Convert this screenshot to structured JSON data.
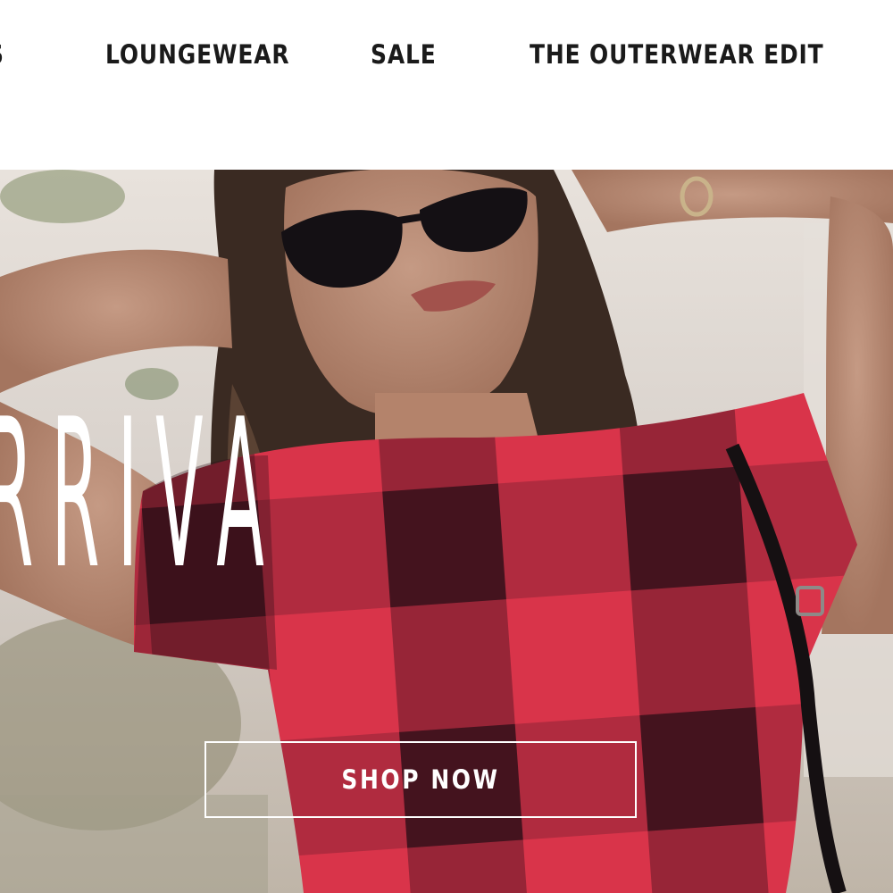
{
  "nav": {
    "items": [
      {
        "label": "S"
      },
      {
        "label": "LOUNGEWEAR"
      },
      {
        "label": "SALE"
      },
      {
        "label": "THE OUTERWEAR EDIT"
      }
    ]
  },
  "hero": {
    "headline": "ARRIVA",
    "cta_label": "SHOP NOW"
  },
  "colors": {
    "nav_text": "#1a1a1a",
    "hero_text": "#ffffff",
    "plaid_red": "#d9344a",
    "plaid_dark": "#3b1420"
  }
}
